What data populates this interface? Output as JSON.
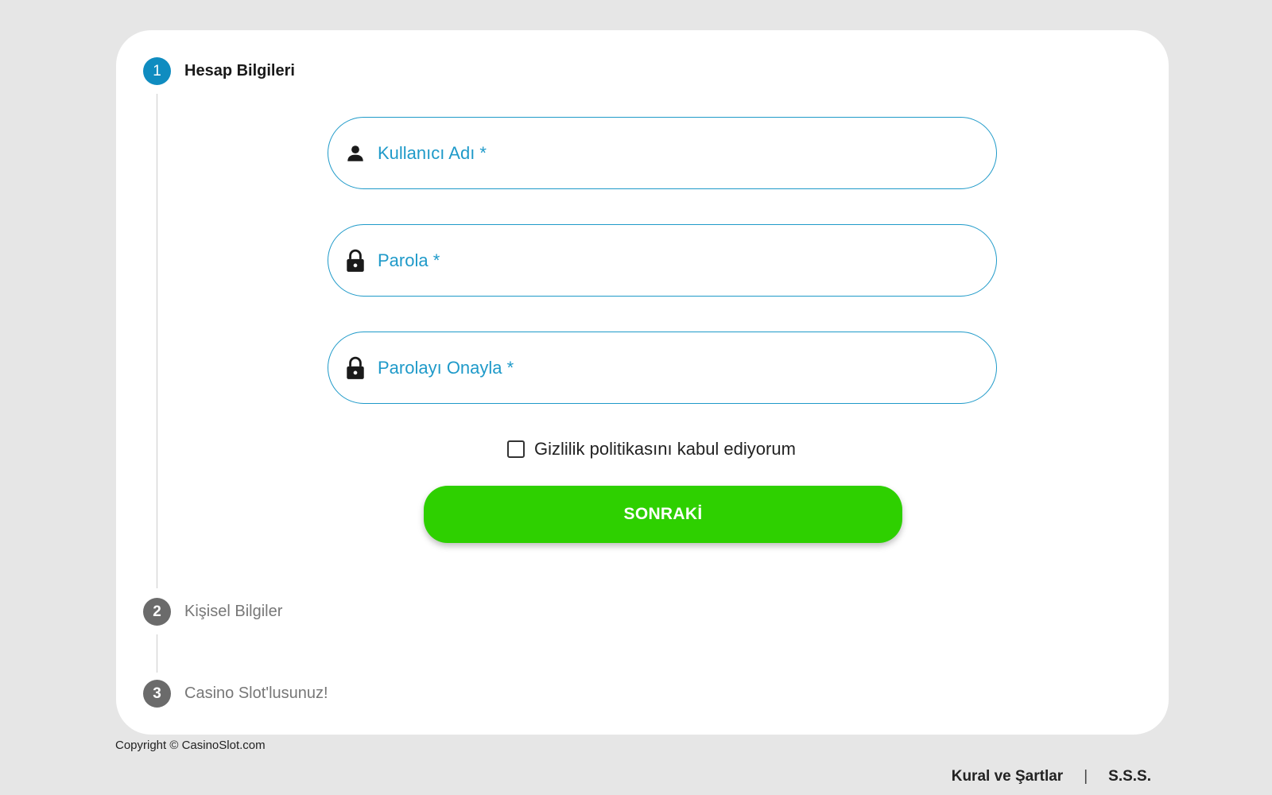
{
  "steps": [
    {
      "number": "1",
      "label": "Hesap Bilgileri",
      "state": "active"
    },
    {
      "number": "2",
      "label": "Kişisel Bilgiler",
      "state": "inactive"
    },
    {
      "number": "3",
      "label": "Casino Slot'lusunuz!",
      "state": "inactive"
    }
  ],
  "form": {
    "username": {
      "placeholder": "Kullanıcı Adı *",
      "value": "",
      "icon": "user-icon"
    },
    "password": {
      "placeholder": "Parola *",
      "value": "",
      "icon": "lock-icon"
    },
    "confirm_password": {
      "placeholder": "Parolayı Onayla *",
      "value": "",
      "icon": "lock-icon"
    },
    "privacy_consent": {
      "label": "Gizlilik politikasını kabul ediyorum",
      "checked": false
    },
    "next_label": "SONRAKİ"
  },
  "footer": {
    "copyright": "Copyright © CasinoSlot.com",
    "links": [
      "Kural ve Şartlar",
      "S.S.S."
    ],
    "separator": "|"
  },
  "colors": {
    "accent": "#1f9ac9",
    "active_step": "#0f8cc0",
    "inactive_step": "#6b6b6b",
    "button": "#2ed000",
    "background": "#e6e6e6"
  }
}
